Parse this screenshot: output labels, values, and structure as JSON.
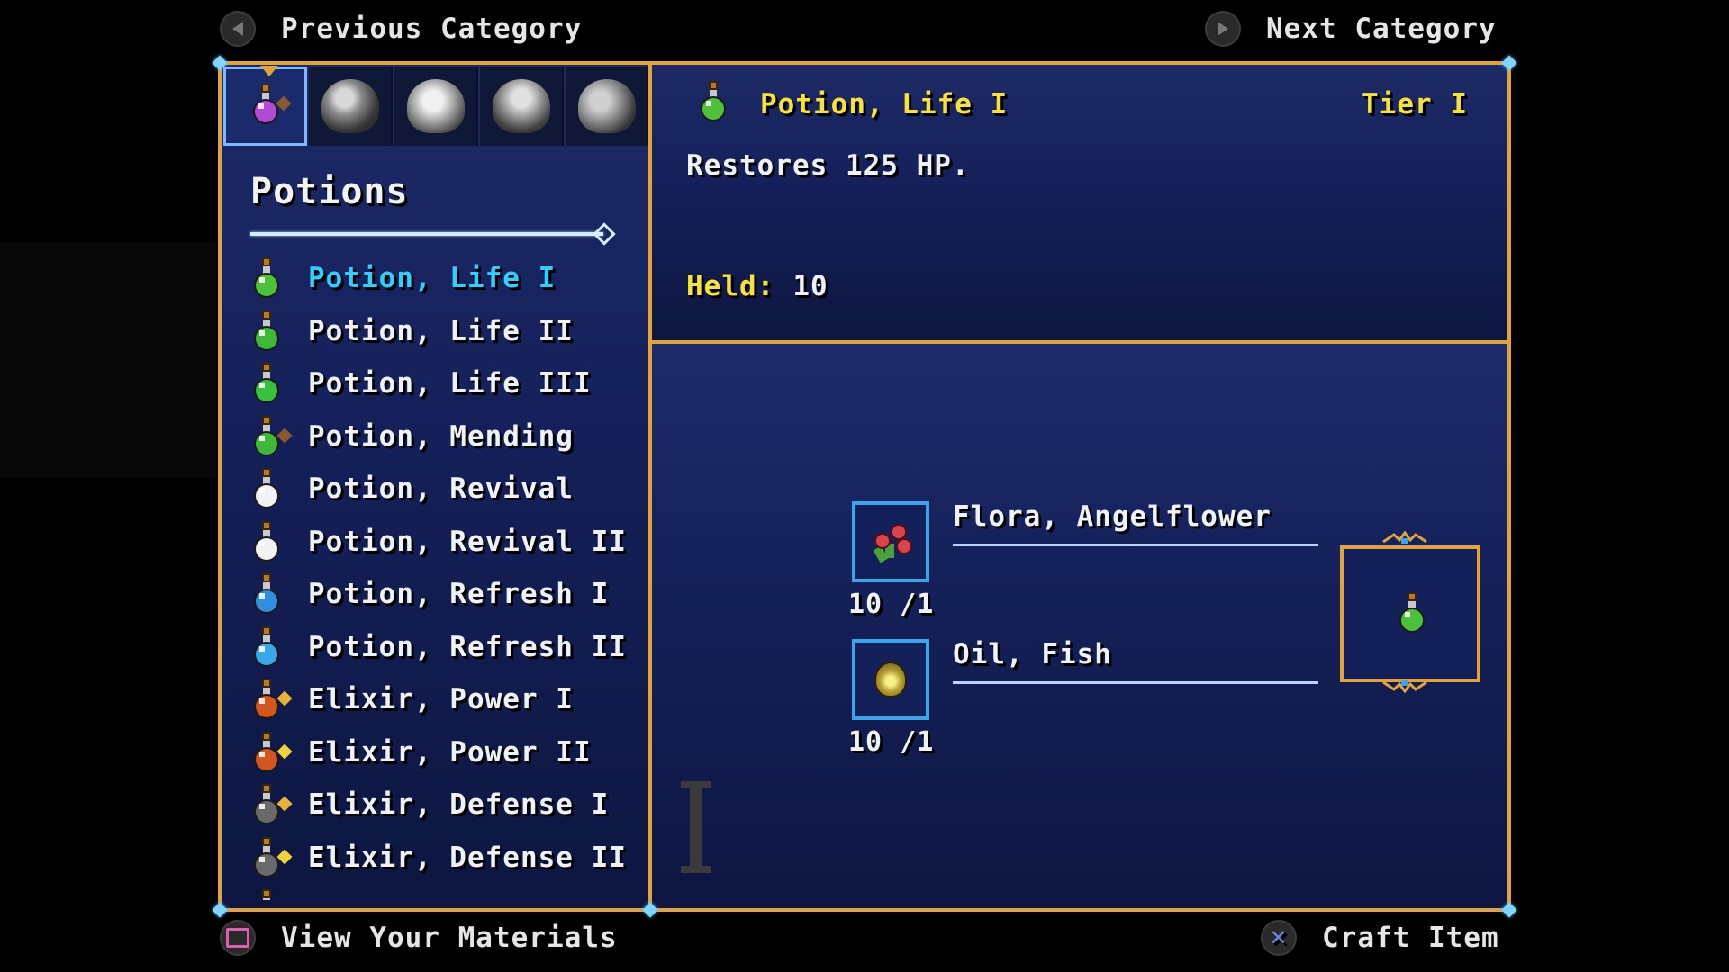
{
  "top_bar": {
    "prev_label": "Previous Category",
    "next_label": "Next Category"
  },
  "bottom_bar": {
    "materials_label": "View Your Materials",
    "craft_label": "Craft Item"
  },
  "category": {
    "title": "Potions",
    "tabs": [
      "potion-category-icon",
      "character-portrait-1",
      "character-portrait-2",
      "character-portrait-3",
      "character-portrait-4"
    ]
  },
  "items": [
    {
      "label": "Potion, Life I",
      "color": "#4cc23a",
      "badge": null
    },
    {
      "label": "Potion, Life II",
      "color": "#3fb83a",
      "badge": null
    },
    {
      "label": "Potion, Life III",
      "color": "#36c23a",
      "badge": null
    },
    {
      "label": "Potion, Mending",
      "color": "#3fb83a",
      "badge": "#8a5a2a"
    },
    {
      "label": "Potion, Revival",
      "color": "#f2f2f2",
      "badge": null
    },
    {
      "label": "Potion, Revival II",
      "color": "#f2f2f2",
      "badge": null
    },
    {
      "label": "Potion, Refresh I",
      "color": "#2f8fe0",
      "badge": null
    },
    {
      "label": "Potion, Refresh II",
      "color": "#3aa6ea",
      "badge": null
    },
    {
      "label": "Elixir, Power I",
      "color": "#d2561e",
      "badge": "#e8b232"
    },
    {
      "label": "Elixir, Power II",
      "color": "#d2561e",
      "badge": "#f2d23a"
    },
    {
      "label": "Elixir, Defense I",
      "color": "#6a6a6a",
      "badge": "#e8b232"
    },
    {
      "label": "Elixir, Defense II",
      "color": "#6a6a6a",
      "badge": "#f2d23a"
    },
    {
      "label": "",
      "color": "#6a6a6a",
      "badge": null
    }
  ],
  "detail": {
    "name": "Potion, Life I",
    "tier": "Tier I",
    "description": "Restores 125 HP.",
    "held_label": "Held:",
    "held_value": "10"
  },
  "recipe": {
    "materials": [
      {
        "name": "Flora, Angelflower",
        "count": "10 /1",
        "icon": "angelflower-icon"
      },
      {
        "name": "Oil, Fish",
        "count": "10 /1",
        "icon": "fish-oil-icon"
      }
    ],
    "result_icon": "potion-life-icon"
  },
  "colors": {
    "frame": "#e2a33a",
    "selected_text": "#2ed0ff",
    "highlight_text": "#f7e23a",
    "slot_border": "#3aa6ea"
  }
}
